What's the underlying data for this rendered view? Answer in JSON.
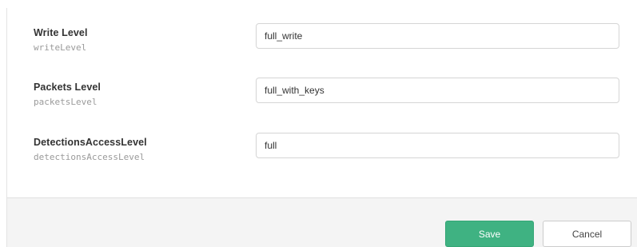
{
  "fields": [
    {
      "label": "Write Level",
      "key": "writeLevel",
      "value": "full_write"
    },
    {
      "label": "Packets Level",
      "key": "packetsLevel",
      "value": "full_with_keys"
    },
    {
      "label": "DetectionsAccessLevel",
      "key": "detectionsAccessLevel",
      "value": "full"
    }
  ],
  "footer": {
    "save_label": "Save",
    "cancel_label": "Cancel"
  },
  "colors": {
    "save_button": "#3fb282",
    "footer_background": "#f4f4f4"
  }
}
